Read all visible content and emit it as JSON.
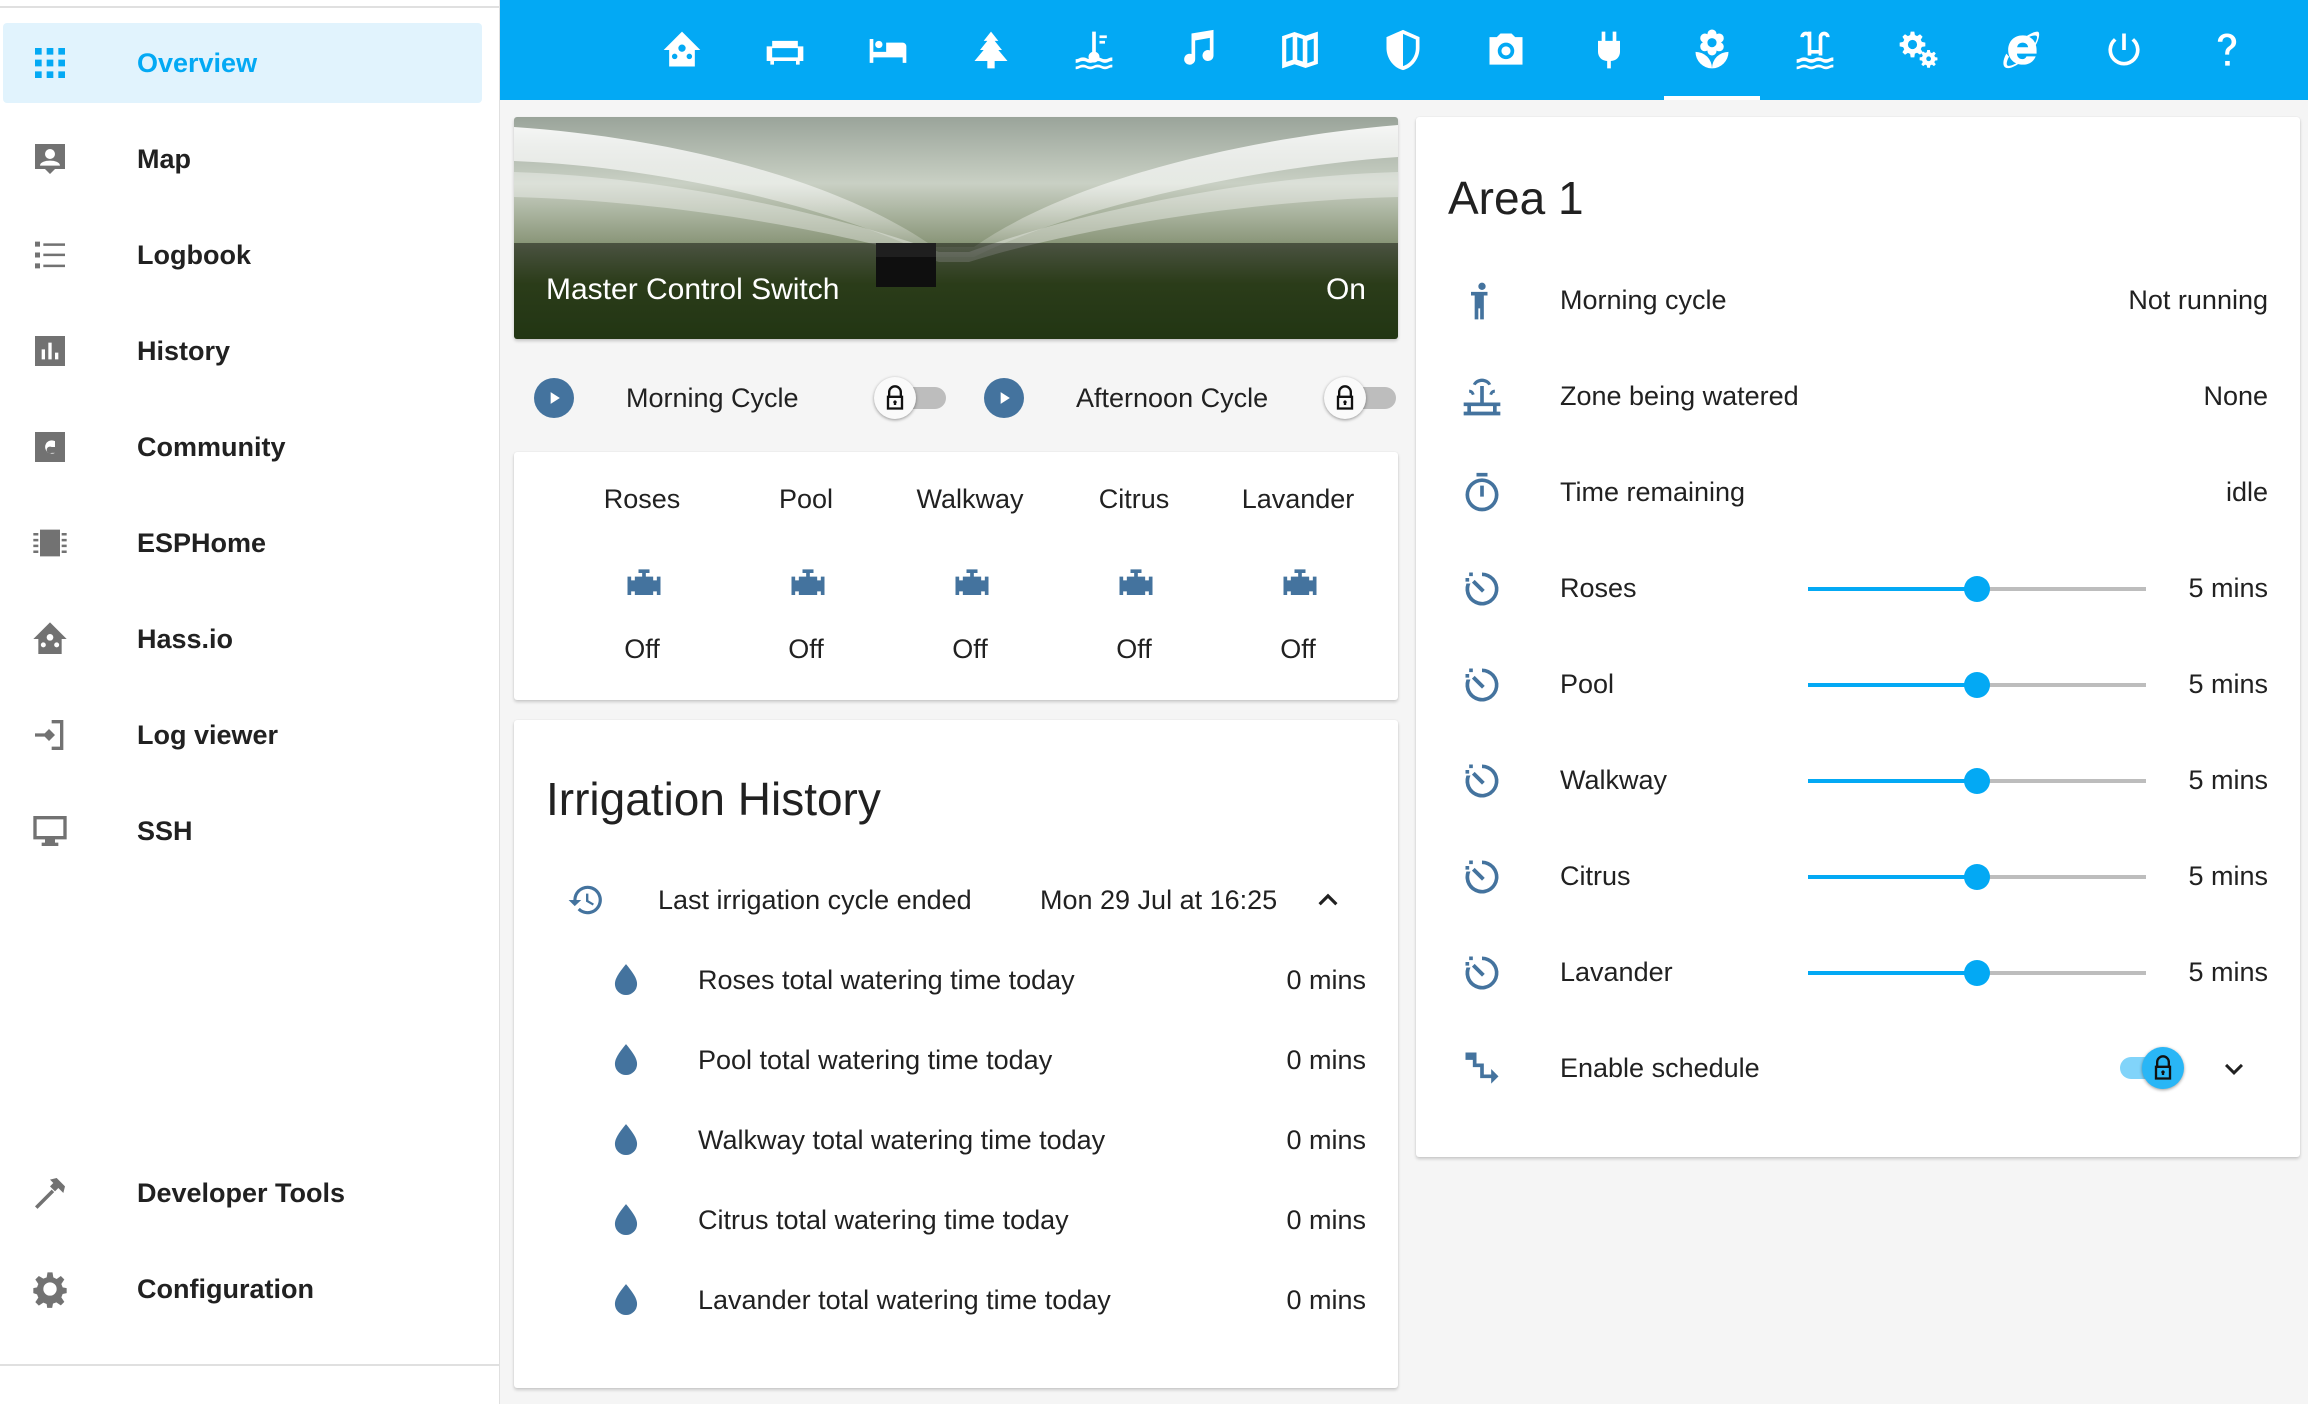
{
  "sidebar": {
    "items": [
      {
        "label": "Overview",
        "icon": "grid-icon"
      },
      {
        "label": "Map",
        "icon": "account-box-icon"
      },
      {
        "label": "Logbook",
        "icon": "list-icon"
      },
      {
        "label": "History",
        "icon": "chart-bar-icon"
      },
      {
        "label": "Community",
        "icon": "community-icon"
      },
      {
        "label": "ESPHome",
        "icon": "chip-icon"
      },
      {
        "label": "Hass.io",
        "icon": "home-assistant-icon"
      },
      {
        "label": "Log viewer",
        "icon": "login-icon"
      },
      {
        "label": "SSH",
        "icon": "monitor-icon"
      }
    ],
    "bottom_items": [
      {
        "label": "Developer Tools",
        "icon": "hammer-icon"
      },
      {
        "label": "Configuration",
        "icon": "gear-icon"
      }
    ]
  },
  "topbar": {
    "tabs": [
      "home-assistant-icon",
      "sofa-icon",
      "bed-icon",
      "pine-tree-icon",
      "pool-thermometer-icon",
      "music-icon",
      "map-icon",
      "shield-icon",
      "camera-icon",
      "power-plug-icon",
      "flower-icon",
      "pool-icon",
      "settings-icon",
      "internet-explorer-icon",
      "power-icon",
      "help-icon"
    ],
    "active_index": 10
  },
  "hero": {
    "title": "Master Control Switch",
    "state": "On"
  },
  "cycles": [
    {
      "label": "Morning Cycle",
      "on": false
    },
    {
      "label": "Afternoon Cycle",
      "on": false
    }
  ],
  "zones": [
    {
      "name": "Roses",
      "state": "Off"
    },
    {
      "name": "Pool",
      "state": "Off"
    },
    {
      "name": "Walkway",
      "state": "Off"
    },
    {
      "name": "Citrus",
      "state": "Off"
    },
    {
      "name": "Lavander",
      "state": "Off"
    }
  ],
  "history": {
    "title": "Irrigation History",
    "last": {
      "label": "Last irrigation cycle ended",
      "value": "Mon 29 Jul at 16:25"
    },
    "rows": [
      {
        "label": "Roses total watering time today",
        "value": "0 mins"
      },
      {
        "label": "Pool total watering time today",
        "value": "0 mins"
      },
      {
        "label": "Walkway total watering time today",
        "value": "0 mins"
      },
      {
        "label": "Citrus total watering time today",
        "value": "0 mins"
      },
      {
        "label": "Lavander total watering time today",
        "value": "0 mins"
      }
    ]
  },
  "area": {
    "title": "Area 1",
    "status": [
      {
        "label": "Morning cycle",
        "value": "Not running",
        "icon": "human-icon"
      },
      {
        "label": "Zone being watered",
        "value": "None",
        "icon": "fountain-icon"
      },
      {
        "label": "Time remaining",
        "value": "idle",
        "icon": "timer-icon"
      }
    ],
    "sliders": [
      {
        "label": "Roses",
        "value": "5 mins",
        "level": 0.5
      },
      {
        "label": "Pool",
        "value": "5 mins",
        "level": 0.5
      },
      {
        "label": "Walkway",
        "value": "5 mins",
        "level": 0.5
      },
      {
        "label": "Citrus",
        "value": "5 mins",
        "level": 0.5
      },
      {
        "label": "Lavander",
        "value": "5 mins",
        "level": 0.5
      }
    ],
    "schedule": {
      "label": "Enable schedule",
      "on": true
    }
  },
  "colors": {
    "accent": "#03a9f4",
    "icon": "#44739e"
  }
}
